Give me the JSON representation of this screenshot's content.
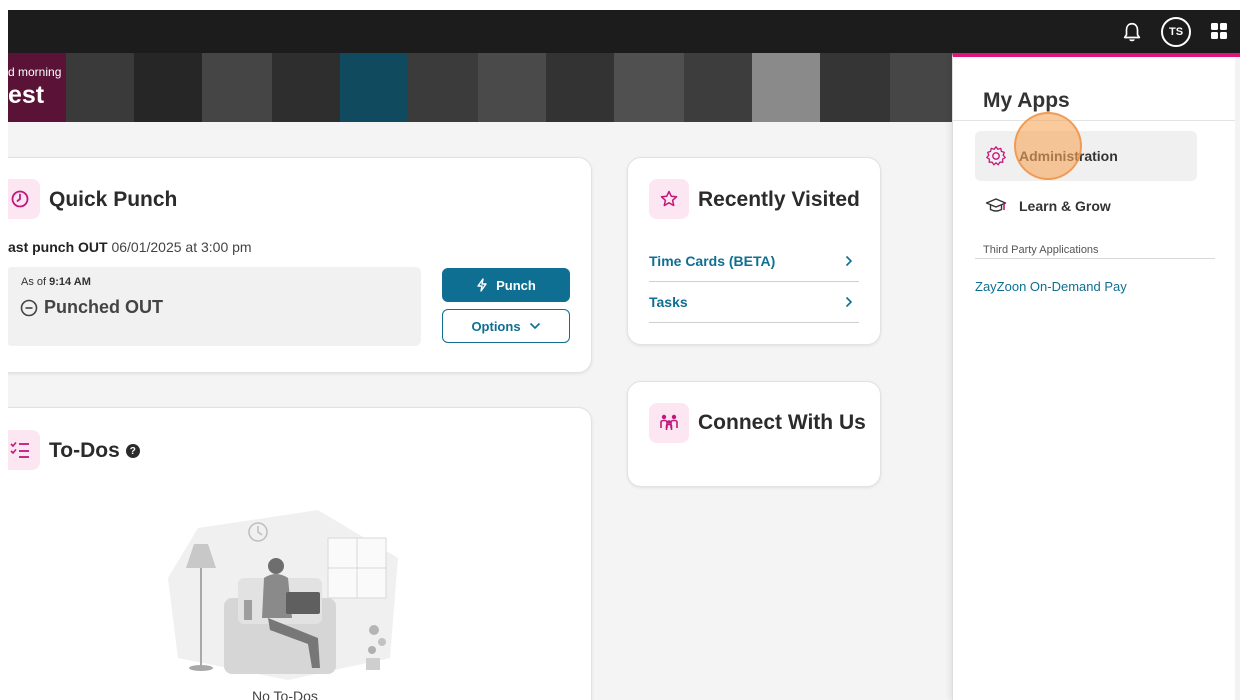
{
  "header": {
    "avatar_initials": "TS",
    "icons": [
      "bell-icon",
      "apps-grid-icon"
    ]
  },
  "banner": {
    "greeting": "d morning",
    "name": "est"
  },
  "quick_punch": {
    "title": "Quick Punch",
    "last_punch_label": "ast punch OUT",
    "last_punch_value": "06/01/2025 at 3:00 pm",
    "as_of_label": "As of",
    "as_of_time": "9:14 AM",
    "status": "Punched OUT",
    "punch_button": "Punch",
    "options_button": "Options"
  },
  "recently_visited": {
    "title": "Recently Visited",
    "links": [
      {
        "label": "Time Cards (BETA)"
      },
      {
        "label": "Tasks"
      }
    ]
  },
  "connect": {
    "title": "Connect With Us"
  },
  "todos": {
    "title": "To-Dos",
    "empty_text": "No To-Dos"
  },
  "drawer": {
    "title": "My Apps",
    "apps": [
      {
        "label": "Administration",
        "icon": "gear-icon",
        "active": true
      },
      {
        "label": "Learn & Grow",
        "icon": "graduation-cap-icon",
        "active": false
      }
    ],
    "third_party_label": "Third Party Applications",
    "third_party_apps": [
      {
        "label": "ZayZoon On-Demand Pay"
      }
    ]
  },
  "colors": {
    "accent_teal": "#0f6f92",
    "accent_pink": "#e0157c",
    "icon_bg_pink": "#fbe6f1",
    "topbar": "#1c1c1c"
  }
}
